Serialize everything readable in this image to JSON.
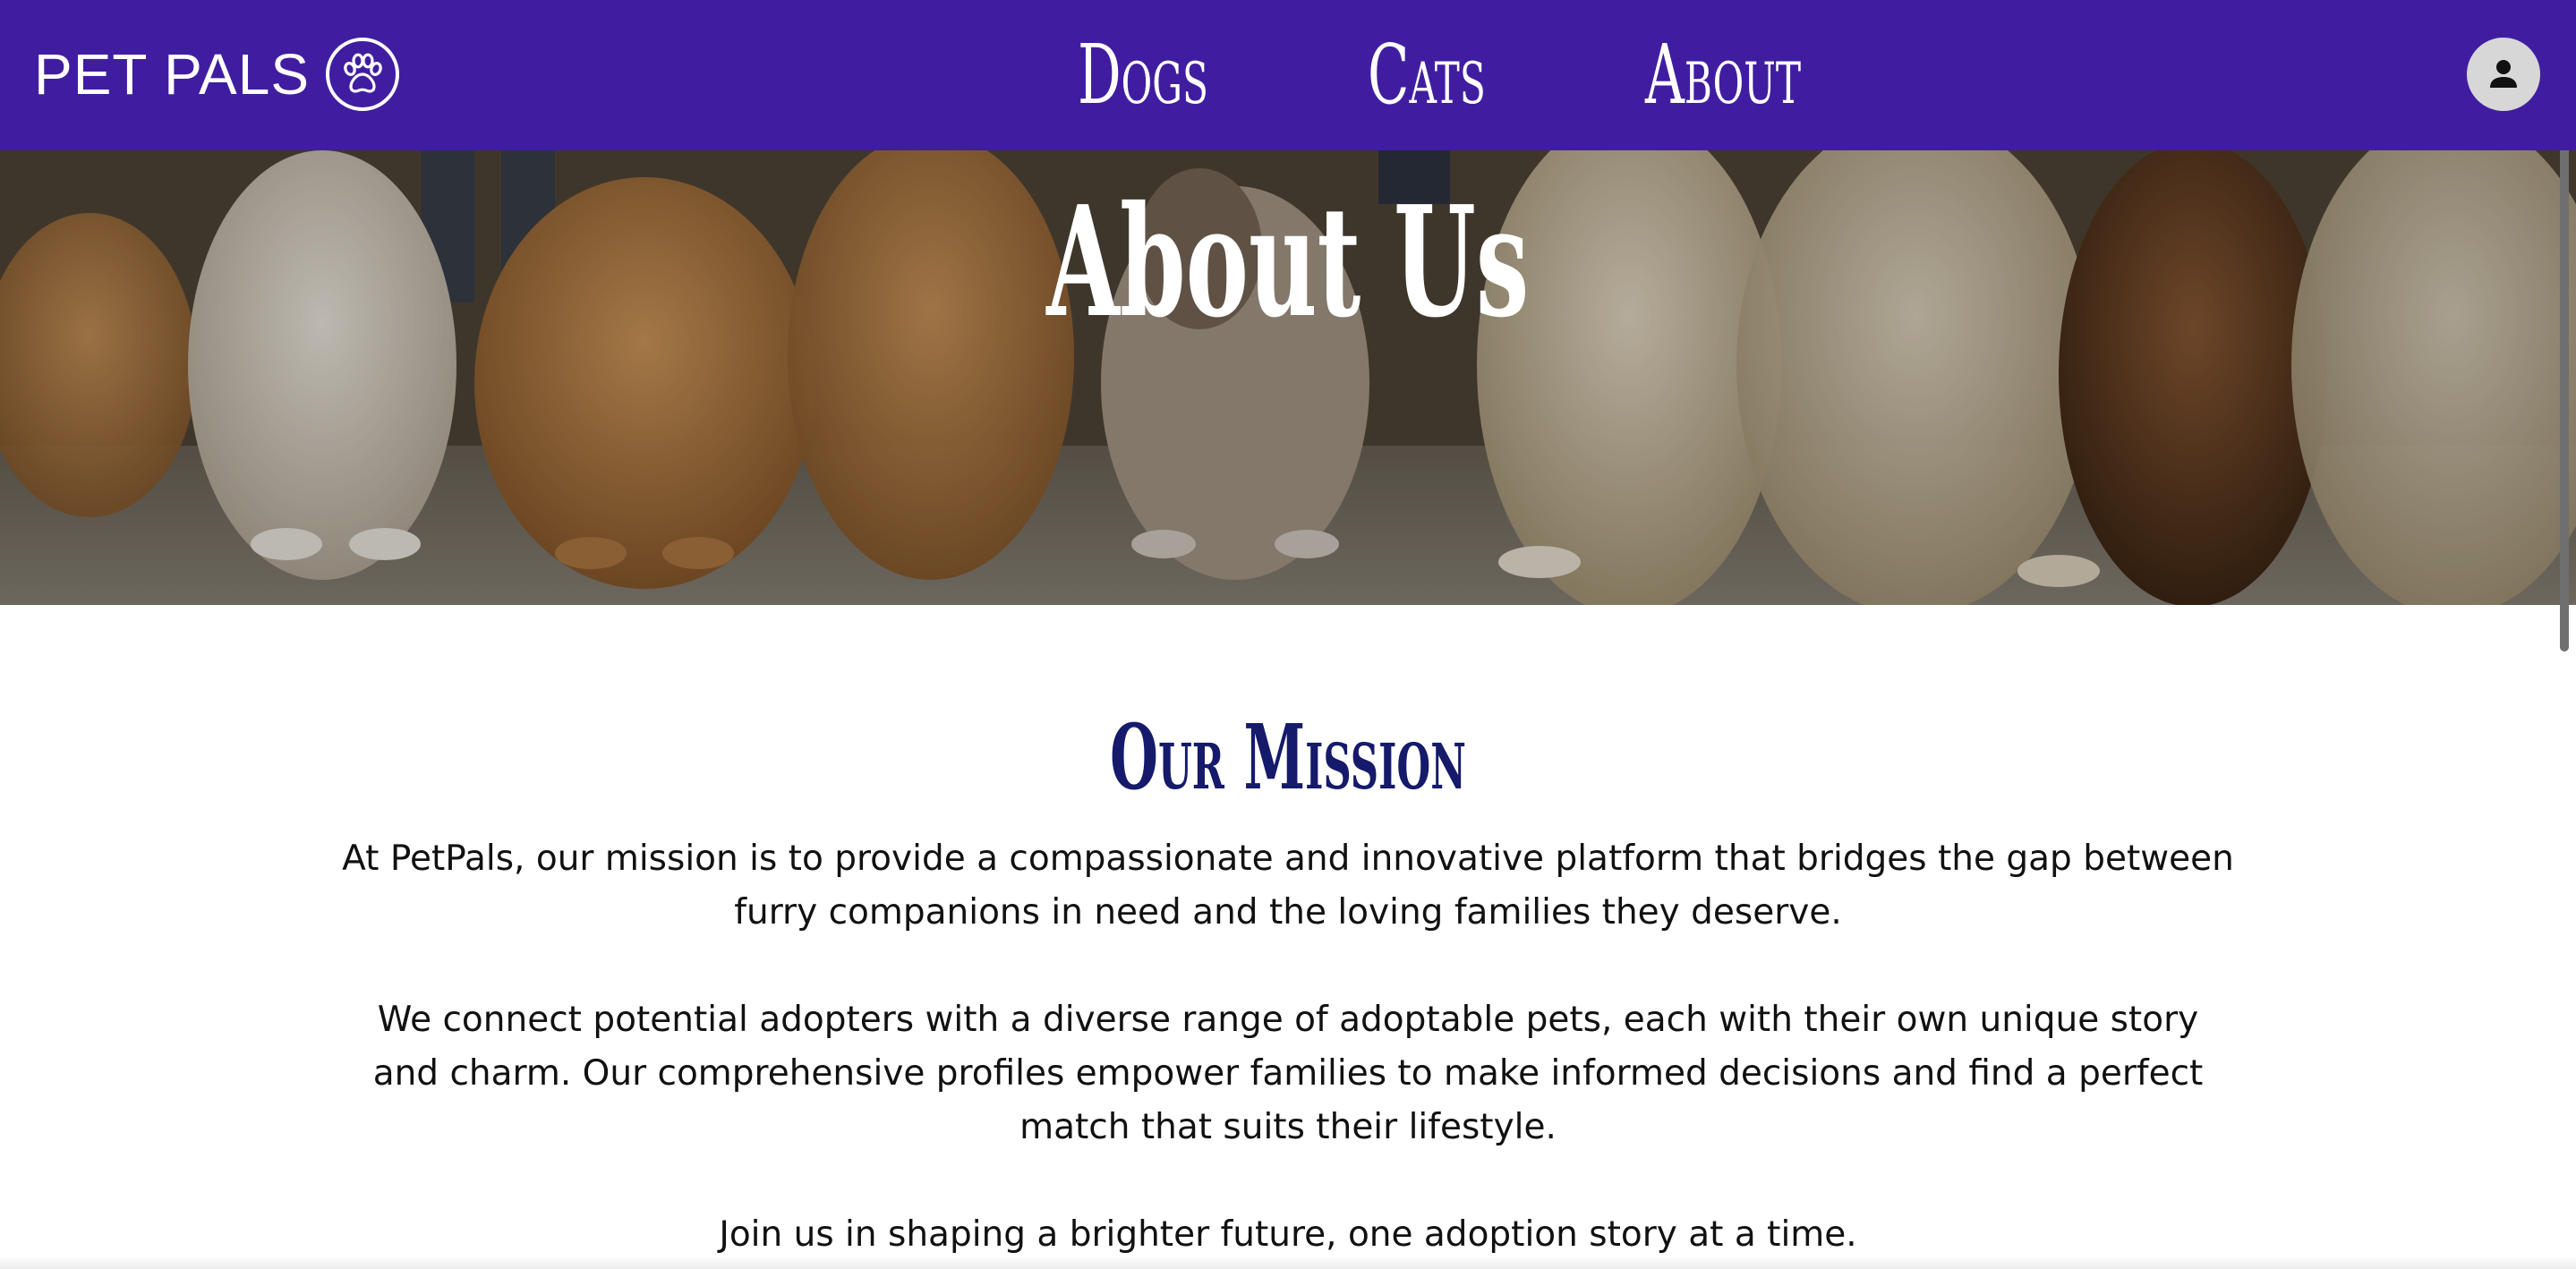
{
  "nav": {
    "brand": "PET PALS",
    "brand_icon": "paw-icon",
    "links": [
      {
        "label": "Dogs"
      },
      {
        "label": "Cats"
      },
      {
        "label": "About"
      }
    ],
    "avatar_icon": "user-icon"
  },
  "hero": {
    "title": "About Us"
  },
  "mission": {
    "heading": "Our Mission",
    "paragraphs": [
      "At PetPals, our mission is to provide a compassionate and innovative platform that bridges the gap between furry companions in need and the loving families they deserve.",
      "We connect potential adopters with a diverse range of adoptable pets, each with their own unique story and charm. Our comprehensive profiles empower families to make informed decisions and find a perfect match that suits their lifestyle.",
      "Join us in shaping a brighter future, one adoption story at a time."
    ]
  },
  "colors": {
    "nav_background": "#401da0",
    "heading_color": "#151a6b",
    "avatar_background": "#d7d7d7"
  }
}
